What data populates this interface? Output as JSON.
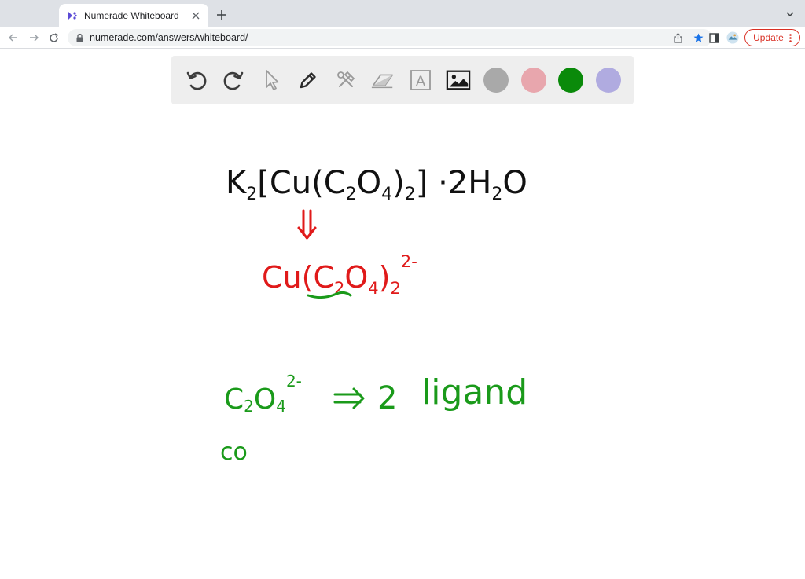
{
  "browser": {
    "tab": {
      "title": "Numerade Whiteboard"
    },
    "address": {
      "url": "numerade.com/answers/whiteboard/"
    },
    "update_label": "Update"
  },
  "icons": {
    "favicon": "numerade-logo-icon",
    "tab_close": "close-icon",
    "new_tab": "plus-icon",
    "back": "arrow-left-icon",
    "forward": "arrow-right-icon",
    "reload": "reload-icon",
    "lock": "lock-icon",
    "share": "share-icon",
    "bookmark": "star-icon",
    "sidepanel": "side-panel-icon",
    "profile": "profile-avatar-icon",
    "menu": "kebab-menu-icon"
  },
  "whiteboard": {
    "tools": [
      {
        "name": "undo",
        "icon": "undo-icon"
      },
      {
        "name": "redo",
        "icon": "redo-icon"
      },
      {
        "name": "select",
        "icon": "cursor-icon"
      },
      {
        "name": "pen",
        "icon": "pen-icon"
      },
      {
        "name": "tools",
        "icon": "hammer-wrench-icon"
      },
      {
        "name": "eraser",
        "icon": "eraser-icon"
      },
      {
        "name": "text",
        "icon": "text-box-icon",
        "glyph": "A"
      },
      {
        "name": "image",
        "icon": "image-icon"
      }
    ],
    "colors": [
      "#a9a9a9",
      "#e8a6ad",
      "#0a8a0a",
      "#b0abe0"
    ],
    "active_color": "#0a8a0a"
  },
  "canvas": {
    "line1": {
      "text": "K2[Cu(C2O4)2]·2H2O",
      "color": "#000000"
    },
    "arrow_down": {
      "glyph": "⇓",
      "color": "#e01a1a"
    },
    "line2": {
      "text": "Cu(C2O4)2 2-",
      "color": "#e01a1a"
    },
    "line3": {
      "text": "C2O4 2- ⇒ 2 ligand",
      "color": "#1a9a1a"
    },
    "line4": {
      "text": "co",
      "color": "#1a9a1a"
    }
  }
}
